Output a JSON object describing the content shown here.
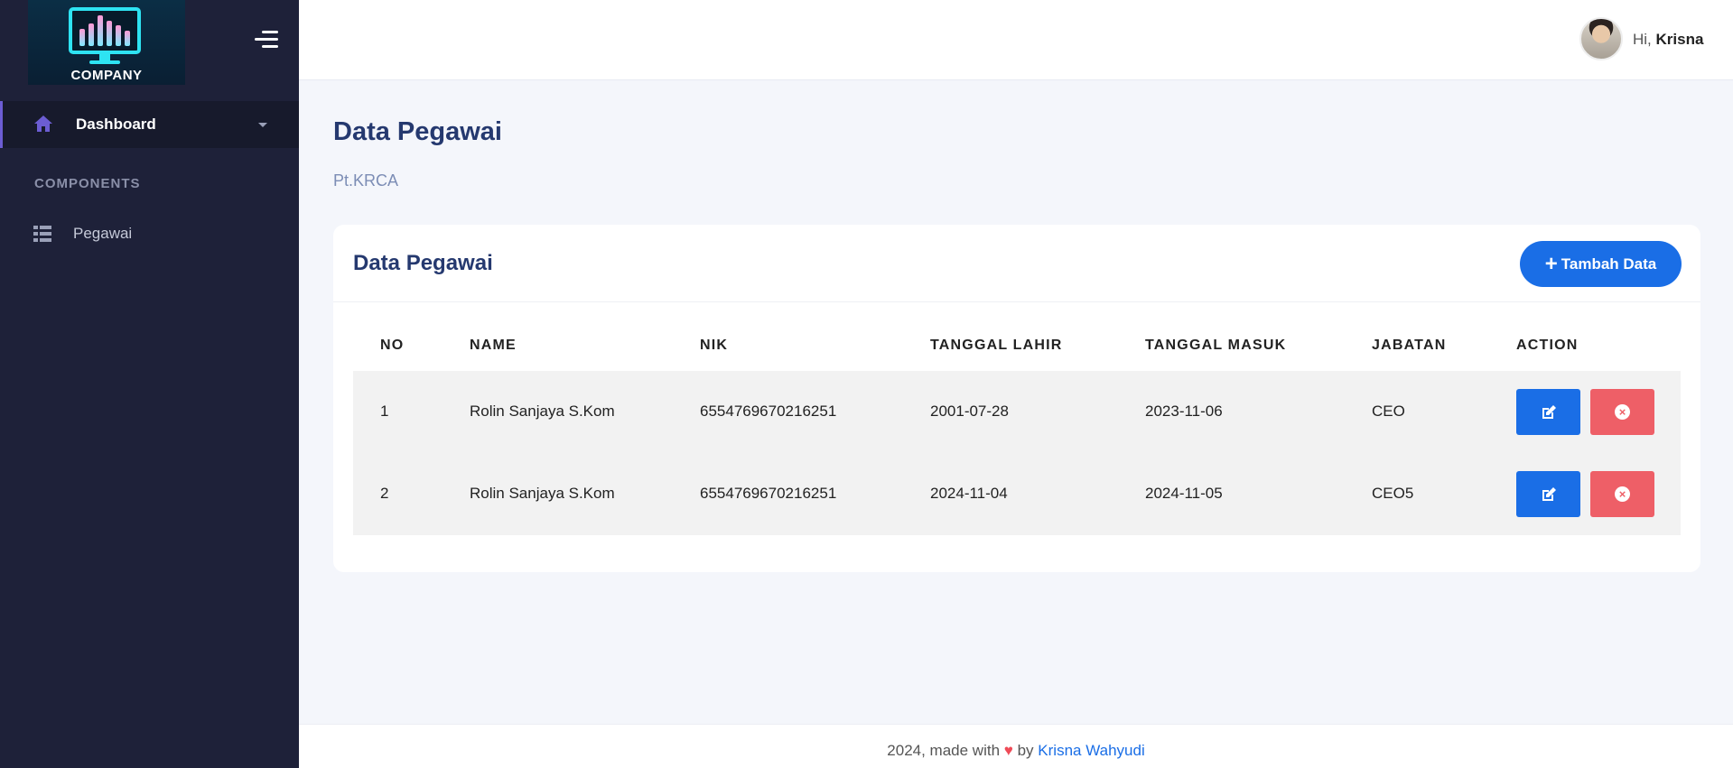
{
  "brand": {
    "logo_text": "COMPANY",
    "chart_bars": [
      0.45,
      0.6,
      0.8,
      0.65,
      0.55,
      0.4
    ]
  },
  "sidebar": {
    "dashboard_label": "Dashboard",
    "section_title": "COMPONENTS",
    "items": [
      {
        "label": "Pegawai",
        "icon": "table-icon"
      }
    ]
  },
  "topbar": {
    "greeting": "Hi,",
    "user_name": "Krisna"
  },
  "page": {
    "title": "Data Pegawai",
    "subtitle": "Pt.KRCA"
  },
  "card": {
    "title": "Data Pegawai",
    "add_button": "Tambah Data"
  },
  "table": {
    "headers": [
      "NO",
      "NAME",
      "NIK",
      "TANGGAL LAHIR",
      "TANGGAL MASUK",
      "JABATAN",
      "ACTION"
    ],
    "rows": [
      {
        "no": "1",
        "name": "Rolin Sanjaya S.Kom",
        "nik": "6554769670216251",
        "tanggal_lahir": "2001-07-28",
        "tanggal_masuk": "2023-11-06",
        "jabatan": "CEO"
      },
      {
        "no": "2",
        "name": "Rolin Sanjaya S.Kom",
        "nik": "6554769670216251",
        "tanggal_lahir": "2024-11-04",
        "tanggal_masuk": "2024-11-05",
        "jabatan": "CEO5"
      }
    ]
  },
  "footer": {
    "text": "2024, made with",
    "by": "by",
    "author": "Krisna Wahyudi"
  },
  "colors": {
    "sidebar_bg": "#1e2139",
    "accent": "#6c5dd3",
    "primary": "#1a6ee6",
    "danger": "#ee5f67",
    "heart": "#ef4b57"
  }
}
